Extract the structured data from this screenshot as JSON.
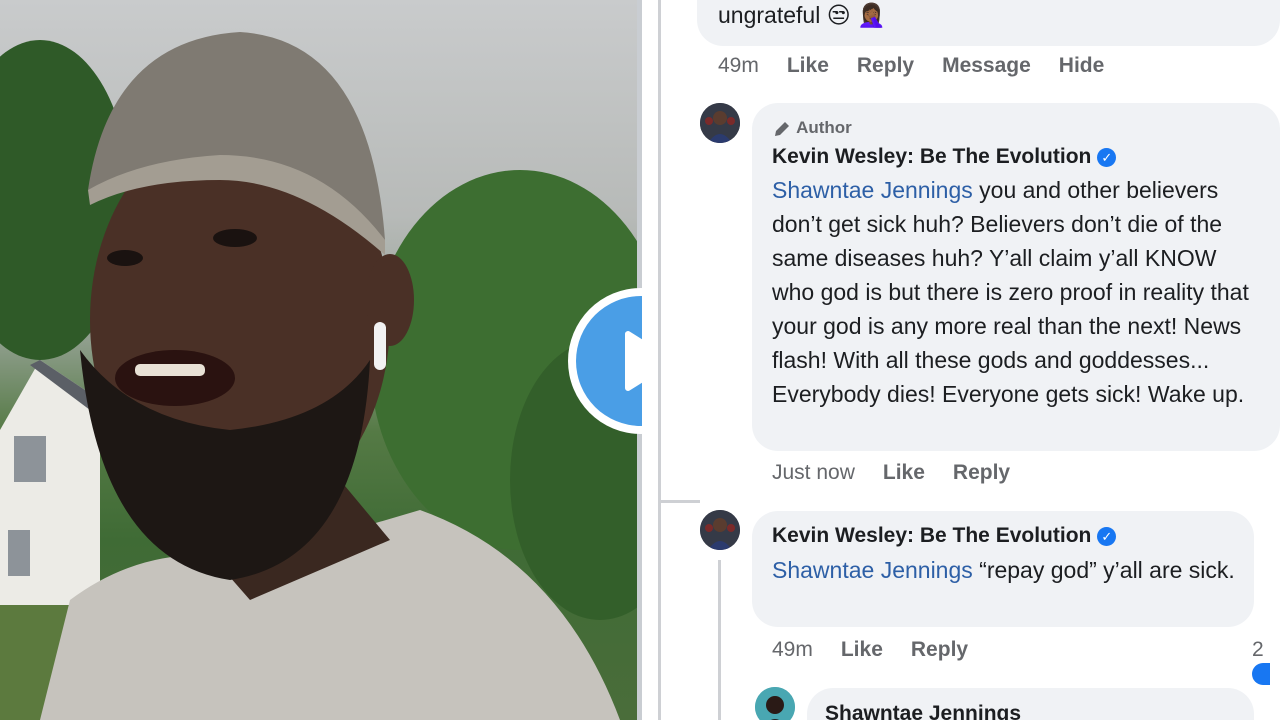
{
  "video": {
    "play_icon": "play-icon"
  },
  "comment_top": {
    "text": "ungrateful",
    "emoji": "😒 🤦🏾‍♀️",
    "time": "49m",
    "like": "Like",
    "reply": "Reply",
    "message": "Message",
    "hide": "Hide"
  },
  "comment_author": {
    "badge": "Author",
    "name": "Kevin Wesley: Be The Evolution",
    "mention": "Shawntae Jennings",
    "text": "you and other believers don’t get sick huh? Believers don’t die of the same diseases huh? Y’all claim y’all KNOW who god is but there is zero proof in reality that your god is any more real than the next! News flash! With all these gods and goddesses... Everybody dies! Everyone gets sick! Wake up.",
    "time": "Just now",
    "like": "Like",
    "reply": "Reply"
  },
  "comment_second": {
    "name": "Kevin Wesley: Be The Evolution",
    "mention": "Shawntae Jennings",
    "text": "“repay god” y’all are sick.",
    "time": "49m",
    "like": "Like",
    "reply": "Reply",
    "reaction_count": "2"
  },
  "comment_third": {
    "name": "Shawntae Jennings"
  },
  "colors": {
    "accent": "#1877f2",
    "mention": "#2d5fa6",
    "bubble": "#f0f2f5"
  }
}
